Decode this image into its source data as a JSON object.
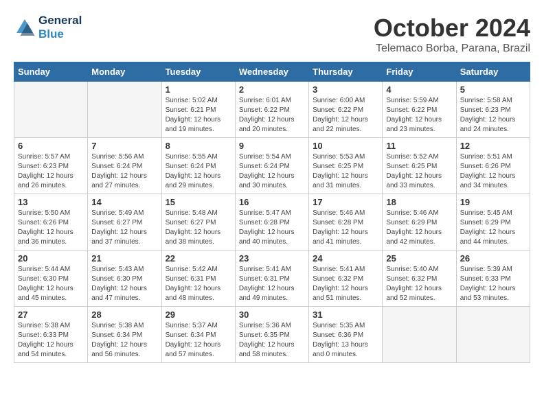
{
  "header": {
    "logo_line1": "General",
    "logo_line2": "Blue",
    "month": "October 2024",
    "location": "Telemaco Borba, Parana, Brazil"
  },
  "days_of_week": [
    "Sunday",
    "Monday",
    "Tuesday",
    "Wednesday",
    "Thursday",
    "Friday",
    "Saturday"
  ],
  "weeks": [
    [
      {
        "day": "",
        "empty": true
      },
      {
        "day": "",
        "empty": true
      },
      {
        "day": "1",
        "sunrise": "5:02 AM",
        "sunset": "6:21 PM",
        "daylight": "12 hours and 19 minutes."
      },
      {
        "day": "2",
        "sunrise": "6:01 AM",
        "sunset": "6:22 PM",
        "daylight": "12 hours and 20 minutes."
      },
      {
        "day": "3",
        "sunrise": "6:00 AM",
        "sunset": "6:22 PM",
        "daylight": "12 hours and 22 minutes."
      },
      {
        "day": "4",
        "sunrise": "5:59 AM",
        "sunset": "6:22 PM",
        "daylight": "12 hours and 23 minutes."
      },
      {
        "day": "5",
        "sunrise": "5:58 AM",
        "sunset": "6:23 PM",
        "daylight": "12 hours and 24 minutes."
      }
    ],
    [
      {
        "day": "6",
        "sunrise": "5:57 AM",
        "sunset": "6:23 PM",
        "daylight": "12 hours and 26 minutes."
      },
      {
        "day": "7",
        "sunrise": "5:56 AM",
        "sunset": "6:24 PM",
        "daylight": "12 hours and 27 minutes."
      },
      {
        "day": "8",
        "sunrise": "5:55 AM",
        "sunset": "6:24 PM",
        "daylight": "12 hours and 29 minutes."
      },
      {
        "day": "9",
        "sunrise": "5:54 AM",
        "sunset": "6:24 PM",
        "daylight": "12 hours and 30 minutes."
      },
      {
        "day": "10",
        "sunrise": "5:53 AM",
        "sunset": "6:25 PM",
        "daylight": "12 hours and 31 minutes."
      },
      {
        "day": "11",
        "sunrise": "5:52 AM",
        "sunset": "6:25 PM",
        "daylight": "12 hours and 33 minutes."
      },
      {
        "day": "12",
        "sunrise": "5:51 AM",
        "sunset": "6:26 PM",
        "daylight": "12 hours and 34 minutes."
      }
    ],
    [
      {
        "day": "13",
        "sunrise": "5:50 AM",
        "sunset": "6:26 PM",
        "daylight": "12 hours and 36 minutes."
      },
      {
        "day": "14",
        "sunrise": "5:49 AM",
        "sunset": "6:27 PM",
        "daylight": "12 hours and 37 minutes."
      },
      {
        "day": "15",
        "sunrise": "5:48 AM",
        "sunset": "6:27 PM",
        "daylight": "12 hours and 38 minutes."
      },
      {
        "day": "16",
        "sunrise": "5:47 AM",
        "sunset": "6:28 PM",
        "daylight": "12 hours and 40 minutes."
      },
      {
        "day": "17",
        "sunrise": "5:46 AM",
        "sunset": "6:28 PM",
        "daylight": "12 hours and 41 minutes."
      },
      {
        "day": "18",
        "sunrise": "5:46 AM",
        "sunset": "6:29 PM",
        "daylight": "12 hours and 42 minutes."
      },
      {
        "day": "19",
        "sunrise": "5:45 AM",
        "sunset": "6:29 PM",
        "daylight": "12 hours and 44 minutes."
      }
    ],
    [
      {
        "day": "20",
        "sunrise": "5:44 AM",
        "sunset": "6:30 PM",
        "daylight": "12 hours and 45 minutes."
      },
      {
        "day": "21",
        "sunrise": "5:43 AM",
        "sunset": "6:30 PM",
        "daylight": "12 hours and 47 minutes."
      },
      {
        "day": "22",
        "sunrise": "5:42 AM",
        "sunset": "6:31 PM",
        "daylight": "12 hours and 48 minutes."
      },
      {
        "day": "23",
        "sunrise": "5:41 AM",
        "sunset": "6:31 PM",
        "daylight": "12 hours and 49 minutes."
      },
      {
        "day": "24",
        "sunrise": "5:41 AM",
        "sunset": "6:32 PM",
        "daylight": "12 hours and 51 minutes."
      },
      {
        "day": "25",
        "sunrise": "5:40 AM",
        "sunset": "6:32 PM",
        "daylight": "12 hours and 52 minutes."
      },
      {
        "day": "26",
        "sunrise": "5:39 AM",
        "sunset": "6:33 PM",
        "daylight": "12 hours and 53 minutes."
      }
    ],
    [
      {
        "day": "27",
        "sunrise": "5:38 AM",
        "sunset": "6:33 PM",
        "daylight": "12 hours and 54 minutes."
      },
      {
        "day": "28",
        "sunrise": "5:38 AM",
        "sunset": "6:34 PM",
        "daylight": "12 hours and 56 minutes."
      },
      {
        "day": "29",
        "sunrise": "5:37 AM",
        "sunset": "6:34 PM",
        "daylight": "12 hours and 57 minutes."
      },
      {
        "day": "30",
        "sunrise": "5:36 AM",
        "sunset": "6:35 PM",
        "daylight": "12 hours and 58 minutes."
      },
      {
        "day": "31",
        "sunrise": "5:35 AM",
        "sunset": "6:36 PM",
        "daylight": "13 hours and 0 minutes."
      },
      {
        "day": "",
        "empty": true
      },
      {
        "day": "",
        "empty": true
      }
    ]
  ],
  "labels": {
    "sunrise": "Sunrise:",
    "sunset": "Sunset:",
    "daylight": "Daylight:"
  }
}
